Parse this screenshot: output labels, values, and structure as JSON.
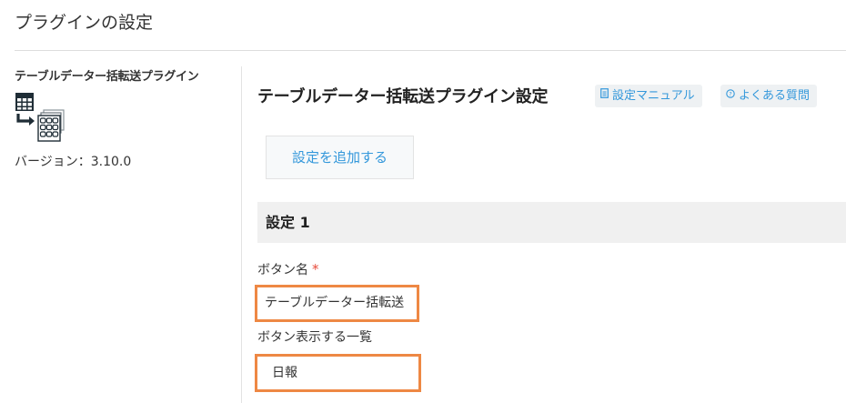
{
  "page": {
    "title": "プラグインの設定"
  },
  "sidebar": {
    "plugin_name": "テーブルデーター括転送プラグイン",
    "icon": "table-transfer-icon",
    "version": "バージョン：3.10.0"
  },
  "main": {
    "title": "テーブルデーター括転送プラグイン設定",
    "links": {
      "manual": {
        "icon": "document-icon",
        "label": "設定マニュアル"
      },
      "faq": {
        "icon": "help-circle-icon",
        "label": "よくある質問"
      }
    },
    "add_button_label": "設定を追加する",
    "setting": {
      "header": "設定 1",
      "fields": {
        "button_name": {
          "label": "ボタン名",
          "required_mark": "*",
          "value": "テーブルデーター括転送"
        },
        "button_views": {
          "label": "ボタン表示する一覧",
          "value": "日報"
        }
      }
    }
  },
  "colors": {
    "link": "#3498db",
    "highlight_border": "#ee8844",
    "required": "#e74c3c",
    "section_header_bg": "#f0f0f0"
  }
}
